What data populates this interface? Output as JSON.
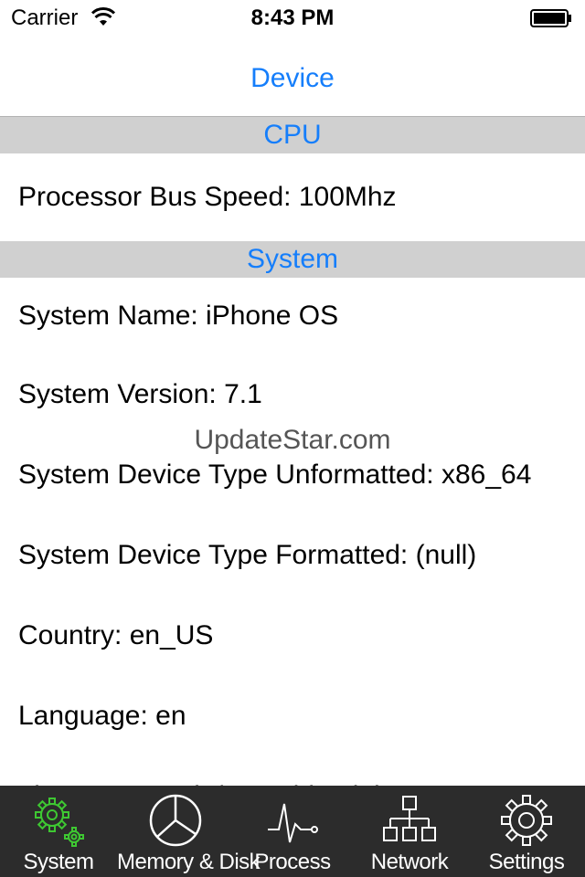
{
  "status_bar": {
    "carrier": "Carrier",
    "time": "8:43 PM"
  },
  "nav": {
    "title": "Device"
  },
  "sections": {
    "cpu": {
      "title": "CPU",
      "rows": [
        "Processor Bus Speed: 100Mhz"
      ]
    },
    "system": {
      "title": "System",
      "rows": [
        "System Name: iPhone OS",
        "System Version: 7.1",
        "System Device Type Unformatted: x86_64",
        "System Device Type Formatted: (null)",
        "Country: en_US",
        "Language: en",
        "Time Zone: Asia/Ho_Chi_Minh"
      ]
    }
  },
  "watermark": "UpdateStar.com",
  "tab_bar": {
    "tabs": [
      {
        "label": "System",
        "icon": "gears-icon",
        "selected": true
      },
      {
        "label": "Memory & Disk",
        "icon": "pie-chart-icon",
        "selected": false
      },
      {
        "label": "Process",
        "icon": "pulse-icon",
        "selected": false
      },
      {
        "label": "Network",
        "icon": "network-icon",
        "selected": false
      },
      {
        "label": "Settings",
        "icon": "gear-icon",
        "selected": false
      }
    ]
  },
  "colors": {
    "accent": "#157efb",
    "tab_selected": "#3ec832",
    "tab_bar_bg": "#2c2c2c",
    "section_bg": "#d0d0d0"
  }
}
